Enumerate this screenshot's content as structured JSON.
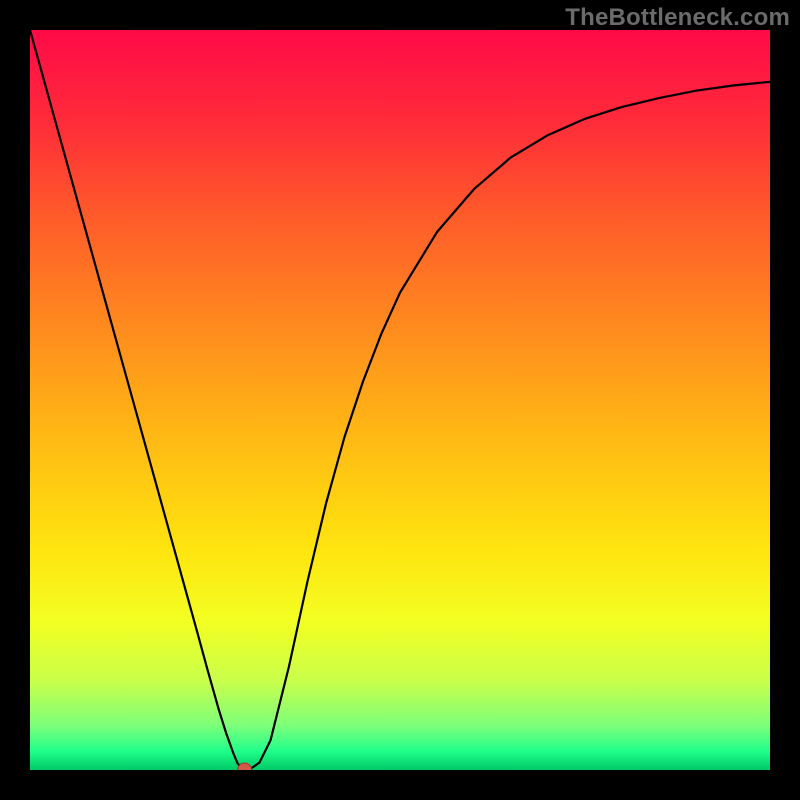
{
  "watermark": "TheBottleneck.com",
  "chart_data": {
    "type": "line",
    "title": "",
    "xlabel": "",
    "ylabel": "",
    "xlim": [
      0,
      1
    ],
    "ylim": [
      0,
      1
    ],
    "grid": false,
    "background_gradient": {
      "stops": [
        {
          "offset": 0.0,
          "color": "#ff0a47"
        },
        {
          "offset": 0.12,
          "color": "#ff2a3a"
        },
        {
          "offset": 0.25,
          "color": "#ff5a2a"
        },
        {
          "offset": 0.4,
          "color": "#ff8a1e"
        },
        {
          "offset": 0.55,
          "color": "#ffb914"
        },
        {
          "offset": 0.7,
          "color": "#ffe40f"
        },
        {
          "offset": 0.8,
          "color": "#f3ff22"
        },
        {
          "offset": 0.88,
          "color": "#c8ff4a"
        },
        {
          "offset": 0.94,
          "color": "#7dff7a"
        },
        {
          "offset": 0.975,
          "color": "#1fff8a"
        },
        {
          "offset": 1.0,
          "color": "#00c866"
        }
      ]
    },
    "series": [
      {
        "name": "bottleneck-curve",
        "color": "#000000",
        "width": 2.2,
        "x": [
          0.0,
          0.025,
          0.05,
          0.075,
          0.1,
          0.125,
          0.15,
          0.175,
          0.2,
          0.225,
          0.24,
          0.255,
          0.265,
          0.27,
          0.275,
          0.28,
          0.285,
          0.29,
          0.3,
          0.31,
          0.325,
          0.35,
          0.375,
          0.4,
          0.425,
          0.45,
          0.475,
          0.5,
          0.55,
          0.6,
          0.65,
          0.7,
          0.75,
          0.8,
          0.85,
          0.9,
          0.95,
          1.0
        ],
        "y": [
          1.0,
          0.91,
          0.82,
          0.73,
          0.64,
          0.55,
          0.46,
          0.37,
          0.28,
          0.19,
          0.135,
          0.082,
          0.05,
          0.036,
          0.022,
          0.01,
          0.003,
          0.0,
          0.003,
          0.01,
          0.04,
          0.14,
          0.255,
          0.36,
          0.45,
          0.525,
          0.59,
          0.645,
          0.727,
          0.785,
          0.828,
          0.858,
          0.88,
          0.896,
          0.908,
          0.918,
          0.925,
          0.93
        ]
      }
    ],
    "markers": [
      {
        "name": "minimum-point",
        "x": 0.29,
        "y": 0.0,
        "r": 7,
        "fill": "#d35a4a",
        "stroke": "#a03a2e"
      }
    ]
  }
}
